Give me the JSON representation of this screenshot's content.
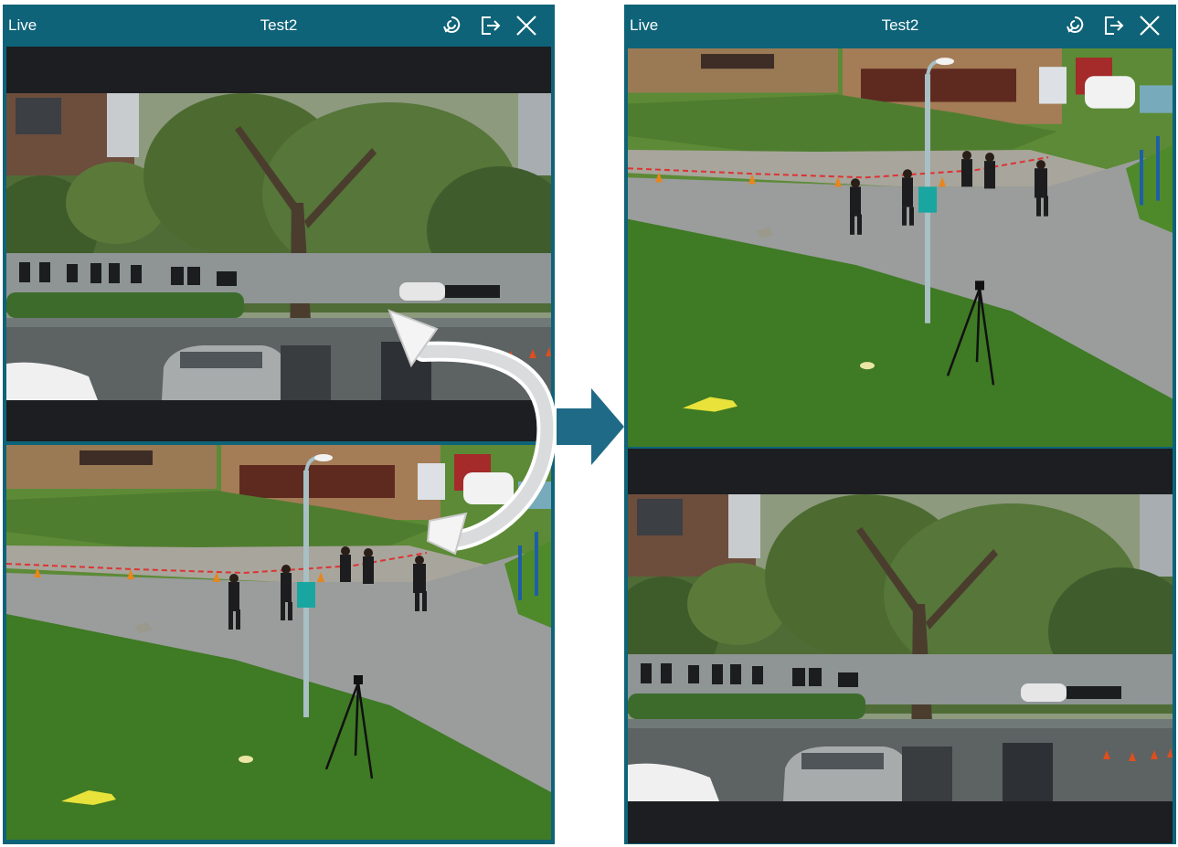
{
  "windows": [
    {
      "mode_label": "Live",
      "title": "Test2"
    },
    {
      "mode_label": "Live",
      "title": "Test2"
    }
  ],
  "icons": {
    "swap_icon": "swap-icon",
    "exit_icon": "exit-icon",
    "close_icon": "close-icon",
    "transition_arrow": "right-arrow-icon"
  },
  "colors": {
    "titlebar": "#0e6378",
    "tile_bg": "#1c1e21",
    "arrow": "#1f6a86"
  }
}
